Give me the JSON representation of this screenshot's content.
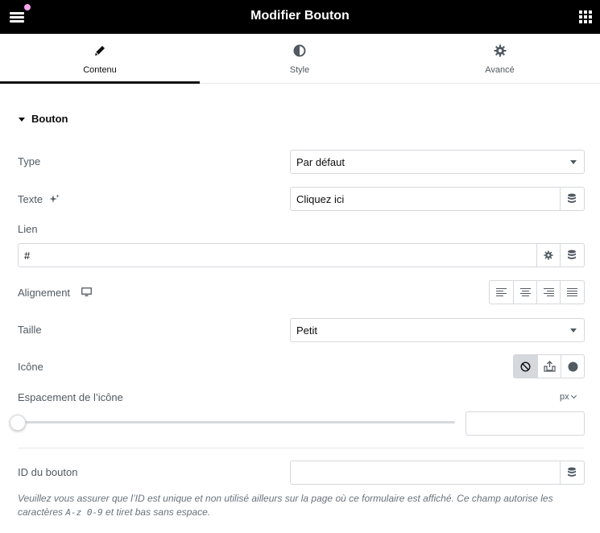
{
  "header": {
    "title": "Modifier Bouton",
    "menu_icon": "hamburger-menu-icon",
    "grid_icon": "apps-grid-icon",
    "notification_color": "#f5a3e8"
  },
  "tabs": [
    {
      "label": "Contenu",
      "icon": "pencil-icon",
      "active": true
    },
    {
      "label": "Style",
      "icon": "half-circle-icon",
      "active": false
    },
    {
      "label": "Avancé",
      "icon": "gear-icon",
      "active": false
    }
  ],
  "section": {
    "title": "Bouton"
  },
  "fields": {
    "type": {
      "label": "Type",
      "value": "Par défaut"
    },
    "texte": {
      "label": "Texte",
      "value": "Cliquez ici"
    },
    "lien": {
      "label": "Lien",
      "value": "#"
    },
    "alignement": {
      "label": "Alignement"
    },
    "taille": {
      "label": "Taille",
      "value": "Petit"
    },
    "icone": {
      "label": "Icône"
    },
    "espacement": {
      "label": "Espacement de l’icône",
      "unit": "px",
      "value": ""
    },
    "id_bouton": {
      "label": "ID du bouton",
      "value": ""
    }
  },
  "description": {
    "part1": "Veuillez vous assurer que l’ID est unique et non utilisé ailleurs sur la page où ce formulaire est affiché. Ce champ autorise les caractères ",
    "code": "A-z 0-9",
    "part2": " et tiret bas sans espace."
  },
  "colors": {
    "header_bg": "#000000",
    "border": "#d5d8dc",
    "text": "#515962",
    "active_text": "#0c0d0e"
  }
}
